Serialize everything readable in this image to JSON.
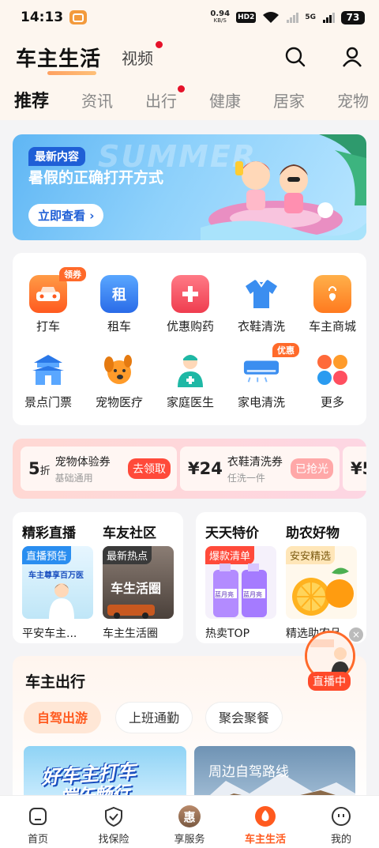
{
  "status_bar": {
    "time": "14:13",
    "speed_value": "0.94",
    "speed_unit": "KB/S",
    "hd": "HD",
    "hd_num": "2",
    "network": "5G",
    "battery": "73"
  },
  "header": {
    "title": "车主生活",
    "video_tab": "视频"
  },
  "category_tabs": [
    "推荐",
    "资讯",
    "出行",
    "健康",
    "居家",
    "宠物"
  ],
  "banner": {
    "badge": "最新内容",
    "title": "暑假的正确打开方式",
    "button": "立即查看 ›",
    "bg_text": "SUMMER"
  },
  "services": [
    {
      "label": "打车",
      "badge": "领券"
    },
    {
      "label": "租车",
      "glyph": "租"
    },
    {
      "label": "优惠购药"
    },
    {
      "label": "衣鞋清洗"
    },
    {
      "label": "车主商城"
    },
    {
      "label": "景点门票"
    },
    {
      "label": "宠物医疗"
    },
    {
      "label": "家庭医生"
    },
    {
      "label": "家电清洗",
      "badge": "优惠"
    },
    {
      "label": "更多"
    }
  ],
  "coupons": [
    {
      "amount": "5",
      "unit": "折",
      "name": "宠物体验券",
      "sub": "基础通用",
      "button": "去领取"
    },
    {
      "amount": "¥24",
      "unit": "",
      "name": "衣鞋清洗券",
      "sub": "任洗一件",
      "button": "已抢光"
    },
    {
      "amount": "¥5",
      "unit": ""
    }
  ],
  "features": {
    "live": {
      "title": "精彩直播",
      "tag": "直播预告",
      "caption": "平安车主...",
      "img_text": "车主尊享百万医"
    },
    "community": {
      "title": "车友社区",
      "tag": "最新热点",
      "caption": "车主生活圈",
      "img_text": "车生活圈"
    },
    "special": {
      "title": "天天特价",
      "tag": "爆款清单",
      "caption": "热卖TOP",
      "img_text": "蓝月亮"
    },
    "farm": {
      "title": "助农好物",
      "tag": "安安精选",
      "caption": "精选助农品"
    }
  },
  "float_live": {
    "button": "直播中",
    "close": "×"
  },
  "travel": {
    "title": "车主出行",
    "chips": [
      "自驾出游",
      "上班通勤",
      "聚会聚餐"
    ],
    "card1_line1": "好车主打车",
    "card1_line2": "端午畅行",
    "card2_title": "周边自驾路线"
  },
  "bottom_nav": [
    {
      "label": "首页"
    },
    {
      "label": "找保险"
    },
    {
      "label": "享服务",
      "glyph": "惠"
    },
    {
      "label": "车主生活"
    },
    {
      "label": "我的"
    }
  ],
  "colors": {
    "accent": "#ff5a1f",
    "badge_red": "#e5122a",
    "banner_blue": "#1f5fd6"
  }
}
